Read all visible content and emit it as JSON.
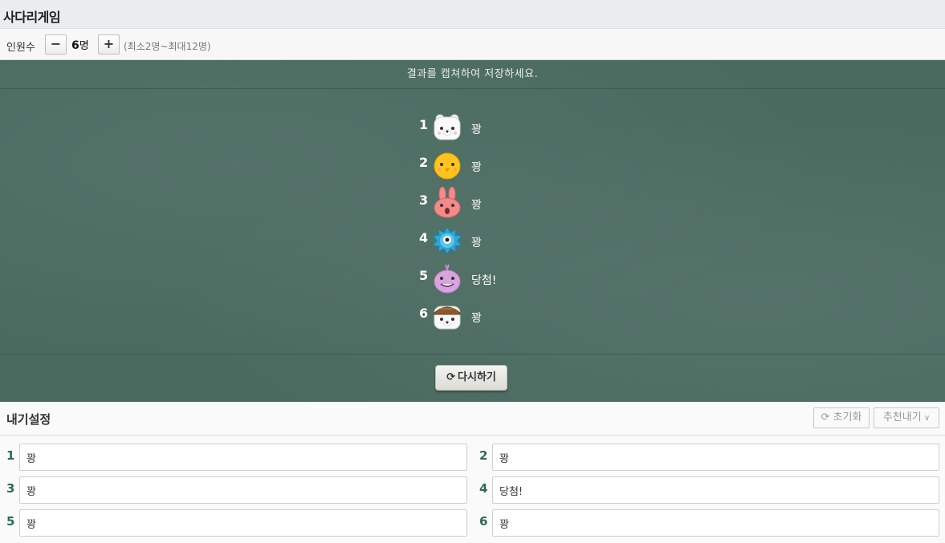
{
  "app": {
    "title": "사다리게임"
  },
  "count_bar": {
    "label": "인원수",
    "minus_label": "−",
    "plus_label": "+",
    "count": "6",
    "unit": "명",
    "hint": "(최소2명~최대12명)"
  },
  "board": {
    "notice": "결과를 캡쳐하여 저장하세요.",
    "results": [
      {
        "num": "1",
        "avatar": "white-bear-icon",
        "text": "꽝"
      },
      {
        "num": "2",
        "avatar": "yellow-chick-icon",
        "text": "꽝"
      },
      {
        "num": "3",
        "avatar": "pink-rabbit-icon",
        "text": "꽝"
      },
      {
        "num": "4",
        "avatar": "blue-hedgehog-icon",
        "text": "꽝"
      },
      {
        "num": "5",
        "avatar": "purple-whale-icon",
        "text": "당첨!"
      },
      {
        "num": "6",
        "avatar": "acorn-hat-bear-icon",
        "text": "꽝"
      }
    ],
    "retry_label": "다시하기",
    "colors": {
      "board": "#4a6a60",
      "text": "#ffffff"
    }
  },
  "settings": {
    "title": "내기설정",
    "reset_label": "초기화",
    "recommend_label": "추천내기",
    "items": [
      {
        "num": "1",
        "value": "꽝"
      },
      {
        "num": "2",
        "value": "꽝"
      },
      {
        "num": "3",
        "value": "꽝"
      },
      {
        "num": "4",
        "value": "당첨!"
      },
      {
        "num": "5",
        "value": "꽝"
      },
      {
        "num": "6",
        "value": "꽝"
      }
    ],
    "colors": {
      "number": "#2e6a55"
    }
  }
}
